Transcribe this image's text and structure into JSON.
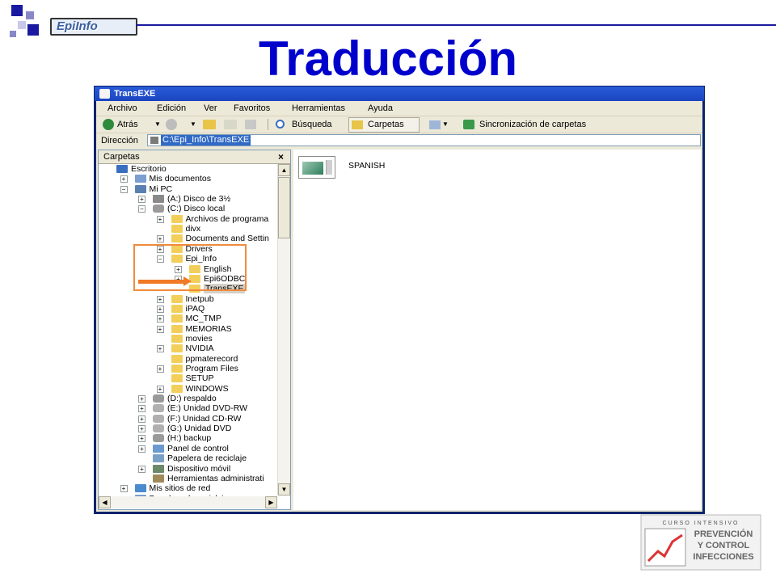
{
  "slide": {
    "title": "Traducción",
    "logo_text": "EpiInfo",
    "footer_logo": {
      "line1": "CURSO INTENSIVO",
      "line2": "PREVENCIÓN",
      "line3": "Y CONTROL",
      "line4": "INFECCIONES"
    }
  },
  "colors": {
    "title": "#0000cc",
    "window_title": "#1b45c0",
    "highlight": "#f08a3c",
    "selection": "#316ac5"
  },
  "window": {
    "title": "TransEXE",
    "menu": [
      "Archivo",
      "Edición",
      "Ver",
      "Favoritos",
      "Herramientas",
      "Ayuda"
    ],
    "toolbar": {
      "back": "Atrás",
      "search": "Búsqueda",
      "folders": "Carpetas",
      "sync": "Sincronización de carpetas"
    },
    "address": {
      "label": "Dirección",
      "value": "C:\\Epi_Info\\TransEXE"
    },
    "folders_panel": {
      "header": "Carpetas",
      "close": "×",
      "tree": [
        {
          "label": "Escritorio",
          "icon": "desktop-icon"
        },
        {
          "label": "Mis documentos",
          "icon": "documents-icon"
        },
        {
          "label": "Mi PC",
          "icon": "computer-icon"
        },
        {
          "label": "(A:) Disco de 3½",
          "icon": "floppy-icon"
        },
        {
          "label": "(C:) Disco local",
          "icon": "drive-icon"
        },
        {
          "label": "Archivos de programa",
          "icon": "folder-icon"
        },
        {
          "label": "divx",
          "icon": "folder-icon"
        },
        {
          "label": "Documents and Settin",
          "icon": "folder-icon"
        },
        {
          "label": "Drivers",
          "icon": "folder-icon"
        },
        {
          "label": "Epi_Info",
          "icon": "folder-open-icon"
        },
        {
          "label": "English",
          "icon": "folder-icon"
        },
        {
          "label": "Epi6ODBC",
          "icon": "folder-icon"
        },
        {
          "label": "TransEXE",
          "icon": "folder-open-icon"
        },
        {
          "label": "Inetpub",
          "icon": "folder-icon"
        },
        {
          "label": "iPAQ",
          "icon": "folder-icon"
        },
        {
          "label": "MC_TMP",
          "icon": "folder-icon"
        },
        {
          "label": "MEMORIAS",
          "icon": "folder-icon"
        },
        {
          "label": "movies",
          "icon": "folder-icon"
        },
        {
          "label": "NVIDIA",
          "icon": "folder-icon"
        },
        {
          "label": "ppmaterecord",
          "icon": "folder-icon"
        },
        {
          "label": "Program Files",
          "icon": "folder-icon"
        },
        {
          "label": "SETUP",
          "icon": "folder-icon"
        },
        {
          "label": "WINDOWS",
          "icon": "folder-icon"
        },
        {
          "label": "(D:) respaldo",
          "icon": "drive-icon"
        },
        {
          "label": "(E:) Unidad DVD-RW",
          "icon": "cd-icon"
        },
        {
          "label": "(F:) Unidad CD-RW",
          "icon": "cd-icon"
        },
        {
          "label": "(G:) Unidad DVD",
          "icon": "cd-icon"
        },
        {
          "label": "(H:) backup",
          "icon": "drive-icon"
        },
        {
          "label": "Panel de control",
          "icon": "control-panel-icon"
        },
        {
          "label": "Papelera de reciclaje",
          "icon": "recycle-bin-icon"
        },
        {
          "label": "Dispositivo móvil",
          "icon": "mobile-icon"
        },
        {
          "label": "Herramientas administrati",
          "icon": "tools-icon"
        },
        {
          "label": "Mis sitios de red",
          "icon": "network-icon"
        },
        {
          "label": "Papelera de reciclaje",
          "icon": "recycle-bin-icon"
        }
      ]
    },
    "content": {
      "items": [
        {
          "label": "SPANISH",
          "icon": "folder-thumbnail-icon"
        }
      ]
    }
  }
}
